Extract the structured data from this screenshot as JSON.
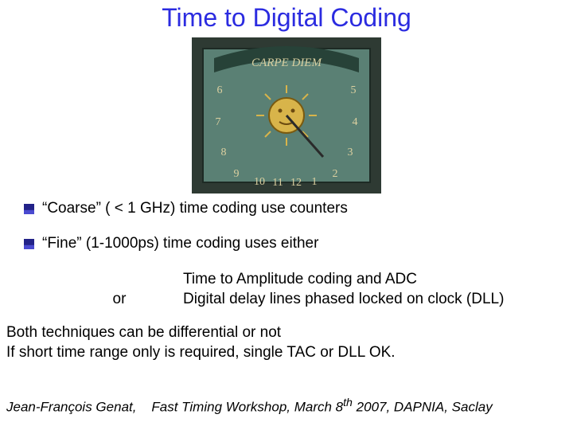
{
  "title": "Time to Digital Coding",
  "image_alt": "Carpe Diem sundial mosaic",
  "bullets": [
    "“Coarse” ( < 1 GHz)  time coding use counters",
    "“Fine”  (1-1000ps) time coding uses either"
  ],
  "sub": {
    "or": "or",
    "line1": "Time to Amplitude coding   and ADC",
    "line2": "Digital delay lines phased locked on clock  (DLL)"
  },
  "plain": [
    "Both techniques can be differential or not",
    "If short time range only is required, single TAC or DLL OK."
  ],
  "footer": {
    "author": "Jean-François  Genat,",
    "event_pre": "Fast Timing Workshop, March 8",
    "event_sup": "th",
    "event_post": " 2007, DAPNIA, Saclay"
  }
}
